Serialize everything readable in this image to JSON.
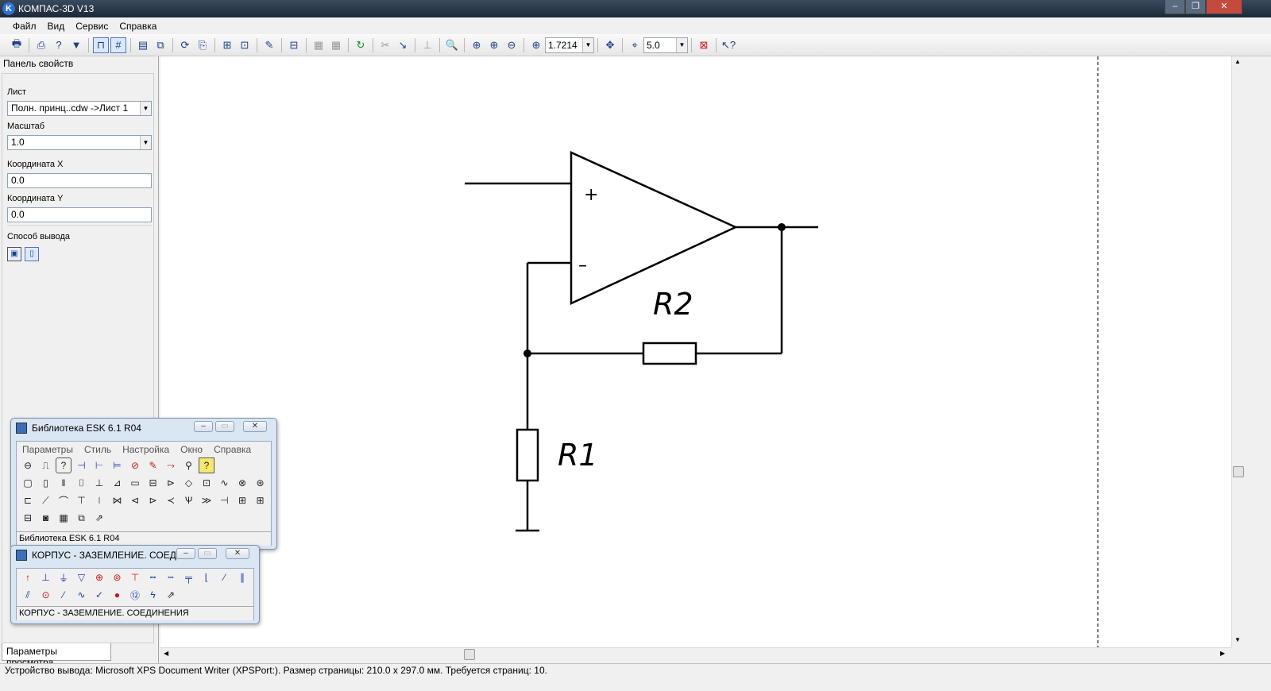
{
  "window": {
    "title": "КОМПАС-3D V13"
  },
  "menu": [
    "Файл",
    "Вид",
    "Сервис",
    "Справка"
  ],
  "toolbar": {
    "zoom_value": "1.7214",
    "step_value": "5.0"
  },
  "properties_panel": {
    "title": "Панель свойств",
    "sheet_label": "Лист",
    "sheet_value": "Полн. принц..cdw ->Лист 1",
    "scale_label": "Масштаб",
    "scale_value": "1.0",
    "x_label": "Координата X",
    "x_value": "0.0",
    "y_label": "Координата Y",
    "y_value": "0.0",
    "output_label": "Способ вывода",
    "tab_label": "Параметры просмотра"
  },
  "drawing": {
    "label_r1": "R1",
    "label_r2": "R2",
    "plus": "+",
    "minus": "–"
  },
  "library_window": {
    "title": "Библиотека ESK 6.1 R04",
    "menu": [
      "Параметры",
      "Стиль",
      "Настройка",
      "Окно",
      "Справка"
    ],
    "status": "Библиотека ESK 6.1 R04"
  },
  "ground_window": {
    "title": "КОРПУС - ЗАЗЕМЛЕНИЕ. СОЕД...",
    "status": "КОРПУС - ЗАЗЕМЛЕНИЕ. СОЕДИНЕНИЯ"
  },
  "status_bar": {
    "text": "Устройство вывода: Microsoft XPS Document Writer (XPSPort:). Размер страницы: 210.0 x 297.0 мм. Требуется страниц: 10."
  }
}
